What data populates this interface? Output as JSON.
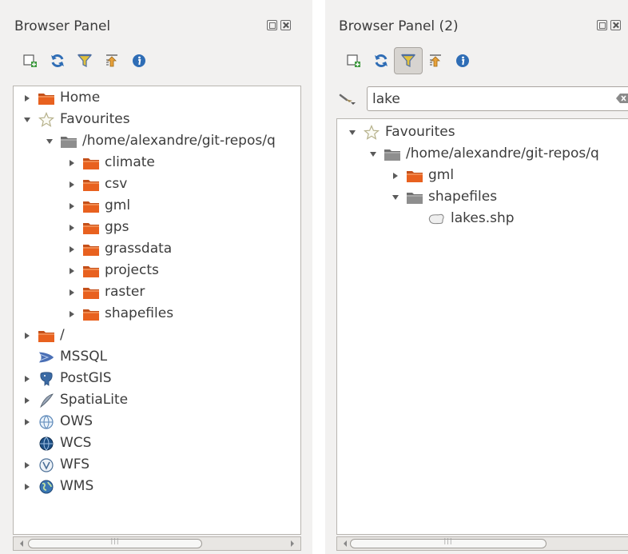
{
  "panel1": {
    "title": "Browser Panel",
    "toolbar": [
      "add-layer",
      "refresh",
      "filter",
      "collapse-all",
      "properties"
    ],
    "tree": [
      {
        "label": "Home",
        "icon": "folder-icon",
        "level": 0,
        "arrow": "collapsed"
      },
      {
        "label": "Favourites",
        "icon": "star-icon",
        "level": 0,
        "arrow": "expanded"
      },
      {
        "label": "/home/alexandre/git-repos/q",
        "icon": "folder-gray-icon",
        "level": 1,
        "arrow": "expanded"
      },
      {
        "label": "climate",
        "icon": "folder-icon",
        "level": 2,
        "arrow": "collapsed"
      },
      {
        "label": "csv",
        "icon": "folder-icon",
        "level": 2,
        "arrow": "collapsed"
      },
      {
        "label": "gml",
        "icon": "folder-icon",
        "level": 2,
        "arrow": "collapsed"
      },
      {
        "label": "gps",
        "icon": "folder-icon",
        "level": 2,
        "arrow": "collapsed"
      },
      {
        "label": "grassdata",
        "icon": "folder-icon",
        "level": 2,
        "arrow": "collapsed"
      },
      {
        "label": "projects",
        "icon": "folder-icon",
        "level": 2,
        "arrow": "collapsed"
      },
      {
        "label": "raster",
        "icon": "folder-icon",
        "level": 2,
        "arrow": "collapsed"
      },
      {
        "label": "shapefiles",
        "icon": "folder-icon",
        "level": 2,
        "arrow": "collapsed"
      },
      {
        "label": "/",
        "icon": "folder-icon",
        "level": 0,
        "arrow": "collapsed"
      },
      {
        "label": "MSSQL",
        "icon": "mssql-icon",
        "level": 0,
        "arrow": "none"
      },
      {
        "label": "PostGIS",
        "icon": "postgis-icon",
        "level": 0,
        "arrow": "collapsed"
      },
      {
        "label": "SpatiaLite",
        "icon": "spatialite-icon",
        "level": 0,
        "arrow": "collapsed"
      },
      {
        "label": "OWS",
        "icon": "ows-icon",
        "level": 0,
        "arrow": "collapsed"
      },
      {
        "label": "WCS",
        "icon": "wcs-icon",
        "level": 0,
        "arrow": "none"
      },
      {
        "label": "WFS",
        "icon": "wfs-icon",
        "level": 0,
        "arrow": "collapsed"
      },
      {
        "label": "WMS",
        "icon": "wms-icon",
        "level": 0,
        "arrow": "collapsed"
      }
    ]
  },
  "panel2": {
    "title": "Browser Panel (2)",
    "filter_value": "lake",
    "tree": [
      {
        "label": "Favourites",
        "icon": "star-icon",
        "level": 0,
        "arrow": "expanded"
      },
      {
        "label": "/home/alexandre/git-repos/q",
        "icon": "folder-gray-icon",
        "level": 1,
        "arrow": "expanded"
      },
      {
        "label": "gml",
        "icon": "folder-icon",
        "level": 2,
        "arrow": "collapsed"
      },
      {
        "label": "shapefiles",
        "icon": "folder-gray-icon",
        "level": 2,
        "arrow": "expanded"
      },
      {
        "label": "lakes.shp",
        "icon": "polygon-layer-icon",
        "level": 3,
        "arrow": "none"
      }
    ]
  },
  "colors": {
    "folder": "#e8611f",
    "panel_bg": "#f2f1f0",
    "toolbar_active": "#d7d4d0"
  }
}
